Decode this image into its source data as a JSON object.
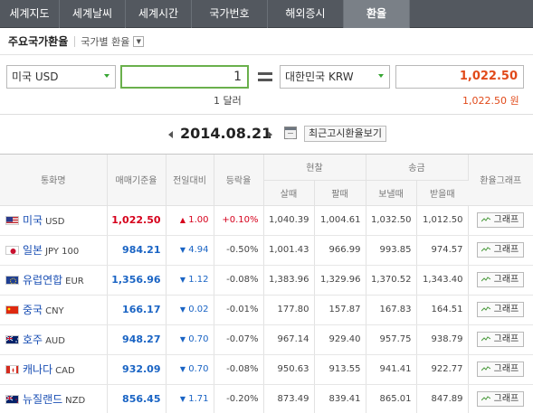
{
  "tabs": [
    {
      "label": "세계지도",
      "active": false
    },
    {
      "label": "세계날씨",
      "active": false
    },
    {
      "label": "세계시간",
      "active": false
    },
    {
      "label": "국가번호",
      "active": false
    },
    {
      "label": "해외증시",
      "active": false
    },
    {
      "label": "환율",
      "active": true
    }
  ],
  "subhead": {
    "title": "주요국가환율",
    "link": "국가별 환율"
  },
  "converter": {
    "from_currency": "미국 USD",
    "from_value": "1",
    "from_caption": "1 달러",
    "to_currency": "대한민국 KRW",
    "to_value": "1,022.50",
    "to_caption": "1,022.50 원"
  },
  "date": {
    "value": "2014.08.21",
    "recent_button": "최근고시환율보기"
  },
  "table": {
    "headers": {
      "name": "통화명",
      "base": "매매기준율",
      "change": "전일대비",
      "rate": "등락율",
      "cash": "현찰",
      "cash_buy": "살때",
      "cash_sell": "팔때",
      "transfer": "송금",
      "transfer_send": "보낼때",
      "transfer_recv": "받을때",
      "graph": "환율그래프"
    },
    "graph_label": "그래프",
    "rows": [
      {
        "kor": "미국",
        "code": "USD",
        "flag": "us",
        "base": "1,022.50",
        "dir": "up",
        "arrow": "▲",
        "change": "1.00",
        "rate": "+0.10%",
        "cash_buy": "1,040.39",
        "cash_sell": "1,004.61",
        "send": "1,032.50",
        "recv": "1,012.50"
      },
      {
        "kor": "일본",
        "code": "JPY 100",
        "flag": "jp",
        "base": "984.21",
        "dir": "down",
        "arrow": "▼",
        "change": "4.94",
        "rate": "-0.50%",
        "cash_buy": "1,001.43",
        "cash_sell": "966.99",
        "send": "993.85",
        "recv": "974.57"
      },
      {
        "kor": "유럽연합",
        "code": "EUR",
        "flag": "eu",
        "base": "1,356.96",
        "dir": "down",
        "arrow": "▼",
        "change": "1.12",
        "rate": "-0.08%",
        "cash_buy": "1,383.96",
        "cash_sell": "1,329.96",
        "send": "1,370.52",
        "recv": "1,343.40"
      },
      {
        "kor": "중국",
        "code": "CNY",
        "flag": "cn",
        "base": "166.17",
        "dir": "down",
        "arrow": "▼",
        "change": "0.02",
        "rate": "-0.01%",
        "cash_buy": "177.80",
        "cash_sell": "157.87",
        "send": "167.83",
        "recv": "164.51"
      },
      {
        "kor": "호주",
        "code": "AUD",
        "flag": "au",
        "base": "948.27",
        "dir": "down",
        "arrow": "▼",
        "change": "0.70",
        "rate": "-0.07%",
        "cash_buy": "967.14",
        "cash_sell": "929.40",
        "send": "957.75",
        "recv": "938.79"
      },
      {
        "kor": "캐나다",
        "code": "CAD",
        "flag": "ca",
        "base": "932.09",
        "dir": "down",
        "arrow": "▼",
        "change": "0.70",
        "rate": "-0.08%",
        "cash_buy": "950.63",
        "cash_sell": "913.55",
        "send": "941.41",
        "recv": "922.77"
      },
      {
        "kor": "뉴질랜드",
        "code": "NZD",
        "flag": "nz",
        "base": "856.45",
        "dir": "down",
        "arrow": "▼",
        "change": "1.71",
        "rate": "-0.20%",
        "cash_buy": "873.49",
        "cash_sell": "839.41",
        "send": "865.01",
        "recv": "847.89"
      }
    ]
  },
  "colors": {
    "up": "#d6001c",
    "down": "#1a64c4",
    "result": "#e14a1a",
    "tab_bg": "#53585f",
    "tab_active": "#7a8087"
  }
}
